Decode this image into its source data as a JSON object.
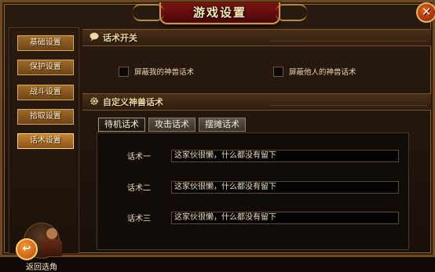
{
  "window": {
    "title": "游戏设置",
    "close_symbol": "✕"
  },
  "sidebar": {
    "items": [
      {
        "label": "基础设置"
      },
      {
        "label": "保护设置"
      },
      {
        "label": "战斗设置"
      },
      {
        "label": "拾取设置"
      },
      {
        "label": "话术设置"
      }
    ],
    "active_index": 4,
    "back_label": "返回选角"
  },
  "speech_toggle": {
    "header": "话术开关",
    "options": [
      {
        "label": "屏蔽我的神兽话术",
        "checked": false
      },
      {
        "label": "屏蔽他人的神兽话术",
        "checked": false
      }
    ]
  },
  "custom_speech": {
    "header": "自定义神兽话术",
    "tabs": [
      {
        "label": "待机话术",
        "active": true
      },
      {
        "label": "攻击话术",
        "active": false
      },
      {
        "label": "摆摊话术",
        "active": false
      }
    ],
    "fields": [
      {
        "label": "话术一",
        "value": "这家伙很懒，什么都没有留下"
      },
      {
        "label": "话术二",
        "value": "这家伙很懒，什么都没有留下"
      },
      {
        "label": "话术三",
        "value": "这家伙很懒，什么都没有留下"
      }
    ]
  },
  "icons": {
    "speech_header": "chat-bubble-icon",
    "custom_header": "gear-icon",
    "back": "back-arrow-icon"
  },
  "colors": {
    "accent_gold": "#d8ab5c",
    "title_red": "#7a1414",
    "text_cream": "#f0d9a0"
  }
}
